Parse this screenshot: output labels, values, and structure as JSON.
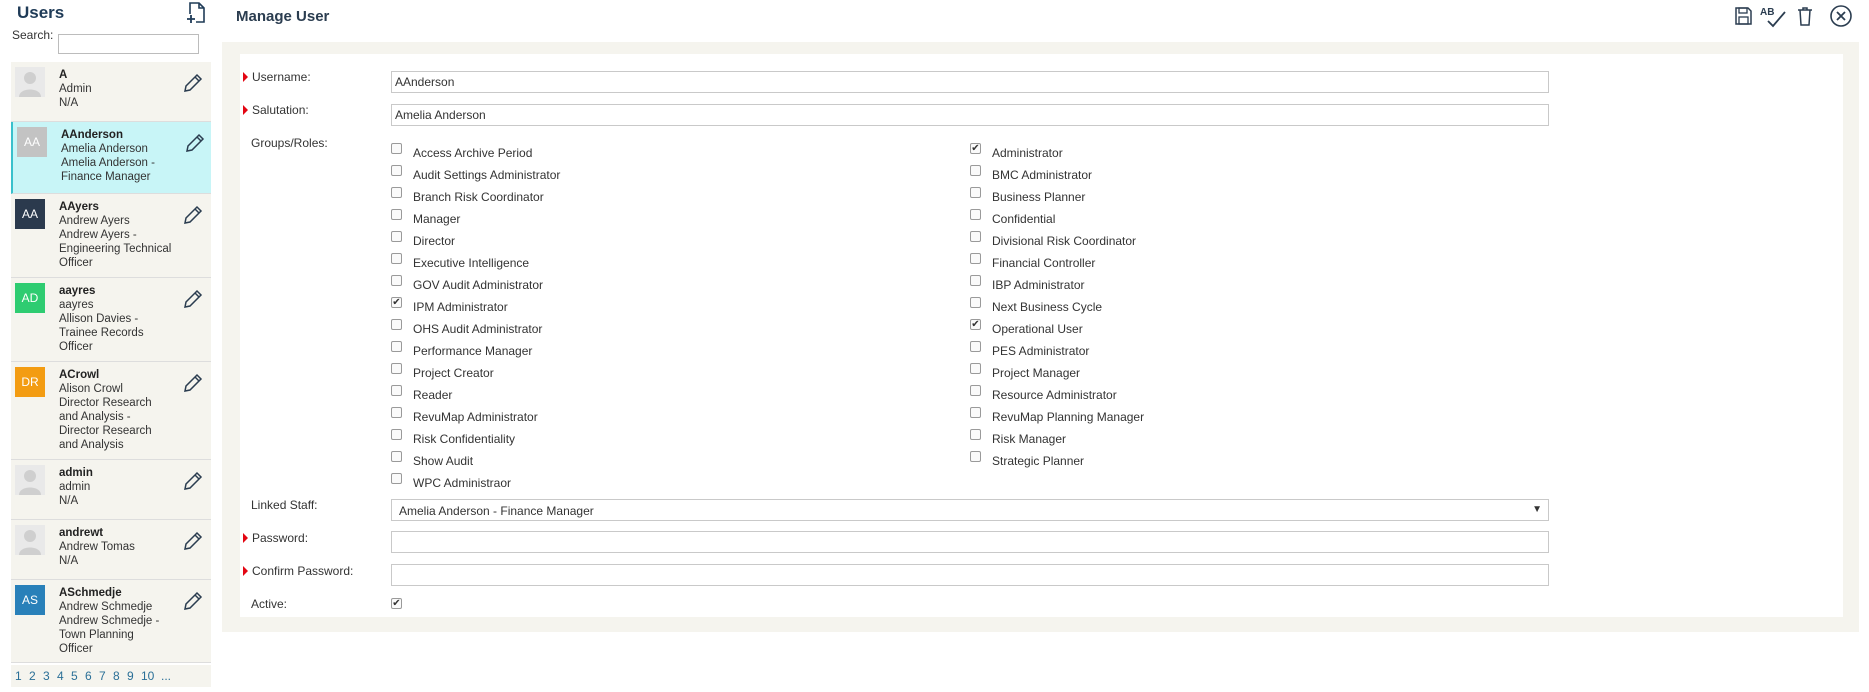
{
  "sidebar": {
    "title": "Users",
    "search_label": "Search:",
    "search_value": "",
    "users": [
      {
        "initials": "",
        "photo": true,
        "color": "",
        "lines": [
          "A",
          "Admin",
          "N/A"
        ]
      },
      {
        "initials": "AA",
        "photo": false,
        "color": "#c3c3c3",
        "lines": [
          "AAnderson",
          "Amelia Anderson",
          "Amelia Anderson -",
          "Finance Manager"
        ]
      },
      {
        "initials": "AA",
        "photo": false,
        "color": "#2b3a4d",
        "lines": [
          "AAyers",
          "Andrew Ayers",
          "Andrew Ayers -",
          "Engineering Technical",
          "Officer"
        ]
      },
      {
        "initials": "AD",
        "photo": false,
        "color": "#2ecc71",
        "lines": [
          "aayres",
          "aayres",
          "Allison Davies -",
          "Trainee Records",
          "Officer"
        ]
      },
      {
        "initials": "DR",
        "photo": false,
        "color": "#f39c12",
        "lines": [
          "ACrowl",
          "Alison Crowl",
          "Director Research",
          "and Analysis -",
          "Director Research",
          "and Analysis"
        ]
      },
      {
        "initials": "",
        "photo": true,
        "color": "",
        "lines": [
          "admin",
          "admin",
          "N/A"
        ]
      },
      {
        "initials": "",
        "photo": true,
        "color": "",
        "lines": [
          "andrewt",
          "Andrew Tomas",
          "N/A"
        ]
      },
      {
        "initials": "AS",
        "photo": false,
        "color": "#2980b9",
        "lines": [
          "ASchmedje",
          "Andrew Schmedje",
          "Andrew Schmedje -",
          "Town Planning",
          "Officer"
        ]
      }
    ],
    "selected_index": 1,
    "pages": [
      "1",
      "2",
      "3",
      "4",
      "5",
      "6",
      "7",
      "8",
      "9",
      "10",
      "..."
    ]
  },
  "main": {
    "title": "Manage User",
    "toolbar": {
      "save_icon": "save-icon",
      "spellcheck_icon": "spellcheck-icon",
      "spellcheck_text": "AB",
      "delete_icon": "trash-icon",
      "close_icon": "close-icon"
    },
    "form": {
      "username_label": "Username:",
      "username_value": "AAnderson",
      "salutation_label": "Salutation:",
      "salutation_value": "Amelia Anderson",
      "groups_label": "Groups/Roles:",
      "roles_left": [
        {
          "label": "Access Archive Period",
          "checked": false
        },
        {
          "label": "Audit Settings Administrator",
          "checked": false
        },
        {
          "label": "Branch Risk Coordinator",
          "checked": false
        },
        {
          "label": "Manager",
          "checked": false
        },
        {
          "label": "Director",
          "checked": false
        },
        {
          "label": "Executive Intelligence",
          "checked": false
        },
        {
          "label": "GOV Audit Administrator",
          "checked": false
        },
        {
          "label": "IPM Administrator",
          "checked": true
        },
        {
          "label": "OHS Audit Administrator",
          "checked": false
        },
        {
          "label": "Performance Manager",
          "checked": false
        },
        {
          "label": "Project Creator",
          "checked": false
        },
        {
          "label": "Reader",
          "checked": false
        },
        {
          "label": "RevuMap Administrator",
          "checked": false
        },
        {
          "label": "Risk Confidentiality",
          "checked": false
        },
        {
          "label": "Show Audit",
          "checked": false
        },
        {
          "label": "WPC Administraor",
          "checked": false
        }
      ],
      "roles_right": [
        {
          "label": "Administrator",
          "checked": true
        },
        {
          "label": "BMC Administrator",
          "checked": false
        },
        {
          "label": "Business Planner",
          "checked": false
        },
        {
          "label": "Confidential",
          "checked": false
        },
        {
          "label": "Divisional Risk Coordinator",
          "checked": false
        },
        {
          "label": "Financial Controller",
          "checked": false
        },
        {
          "label": "IBP Administrator",
          "checked": false
        },
        {
          "label": "Next Business Cycle",
          "checked": false
        },
        {
          "label": "Operational User",
          "checked": true
        },
        {
          "label": "PES Administrator",
          "checked": false
        },
        {
          "label": "Project Manager",
          "checked": false
        },
        {
          "label": "Resource Administrator",
          "checked": false
        },
        {
          "label": "RevuMap Planning Manager",
          "checked": false
        },
        {
          "label": "Risk Manager",
          "checked": false
        },
        {
          "label": "Strategic Planner",
          "checked": false
        }
      ],
      "linked_staff_label": "Linked Staff:",
      "linked_staff_value": "Amelia Anderson - Finance Manager",
      "password_label": "Password:",
      "password_value": "",
      "confirm_password_label": "Confirm Password:",
      "confirm_password_value": "",
      "active_label": "Active:",
      "active_checked": true
    }
  },
  "colors": {
    "accent": "#39c0cc",
    "selected_bg": "#c8f5f7",
    "required": "#e30613",
    "title": "#1f3b57",
    "panel_bg": "#f5f4ee"
  }
}
